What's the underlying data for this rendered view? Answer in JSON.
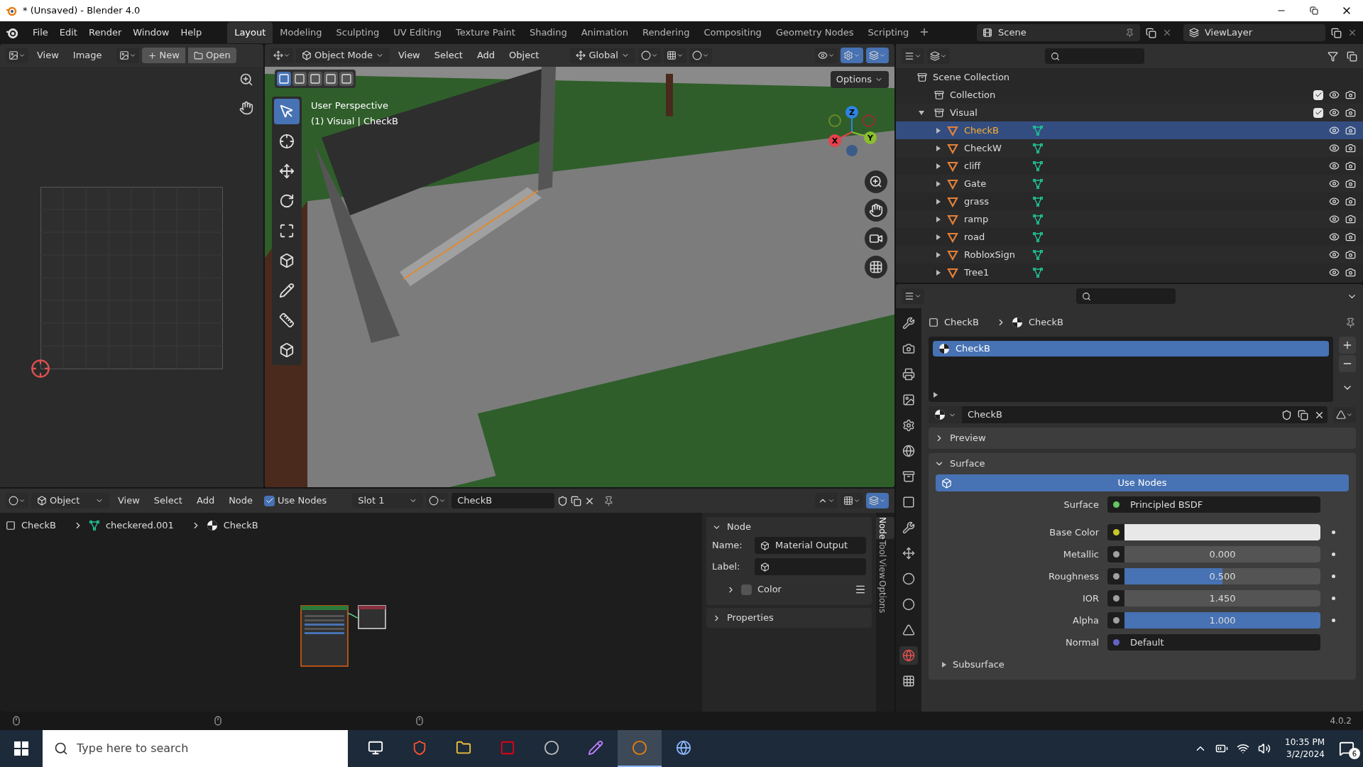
{
  "window": {
    "title": "* (Unsaved) - Blender 4.0"
  },
  "menu": [
    "File",
    "Edit",
    "Render",
    "Window",
    "Help"
  ],
  "workspaces": [
    {
      "label": "Layout",
      "selected": true
    },
    {
      "label": "Modeling",
      "selected": false
    },
    {
      "label": "Sculpting",
      "selected": false
    },
    {
      "label": "UV Editing",
      "selected": false
    },
    {
      "label": "Texture Paint",
      "selected": false
    },
    {
      "label": "Shading",
      "selected": false
    },
    {
      "label": "Animation",
      "selected": false
    },
    {
      "label": "Rendering",
      "selected": false
    },
    {
      "label": "Compositing",
      "selected": false
    },
    {
      "label": "Geometry Nodes",
      "selected": false
    },
    {
      "label": "Scripting",
      "selected": false
    }
  ],
  "scene": "Scene",
  "view_layer": "ViewLayer",
  "image_editor": {
    "menu": [
      "View",
      "Image"
    ],
    "new_button": "New",
    "open_button": "Open"
  },
  "viewport": {
    "mode": "Object Mode",
    "menu": [
      "View",
      "Select",
      "Add",
      "Object"
    ],
    "orientation": "Global",
    "options": "Options",
    "info": [
      "User Perspective",
      "(1) Visual | CheckB"
    ],
    "axes": [
      "Z",
      "Y",
      "X"
    ]
  },
  "outliner": {
    "root": "Scene Collection",
    "collections": [
      {
        "name": "Collection",
        "checked": true
      },
      {
        "name": "Visual",
        "checked": true,
        "expanded": true,
        "children": [
          {
            "name": "CheckB",
            "selected": true
          },
          {
            "name": "CheckW",
            "selected": false
          },
          {
            "name": "cliff",
            "selected": false
          },
          {
            "name": "Gate",
            "selected": false
          },
          {
            "name": "grass",
            "selected": false
          },
          {
            "name": "ramp",
            "selected": false
          },
          {
            "name": "road",
            "selected": false
          },
          {
            "name": "RobloxSign",
            "selected": false
          },
          {
            "name": "Tree1",
            "selected": false
          }
        ]
      }
    ]
  },
  "properties": {
    "breadcrumb": [
      "CheckB",
      "CheckB"
    ],
    "slots": [
      {
        "name": "CheckB",
        "selected": true
      }
    ],
    "material": "CheckB",
    "panels": [
      {
        "title": "Preview",
        "expanded": false
      },
      {
        "title": "Surface",
        "expanded": true
      }
    ],
    "use_nodes": "Use Nodes",
    "fields": [
      {
        "kind": "link",
        "label": "Surface",
        "value": "Principled BSDF",
        "color": "#63c763"
      },
      {
        "kind": "color",
        "label": "Base Color",
        "color": "#c7c729"
      },
      {
        "kind": "number",
        "label": "Metallic",
        "value": "0.000",
        "color": "#a1a1a1"
      },
      {
        "kind": "slider",
        "label": "Roughness",
        "value": "0.500",
        "level": 0.5,
        "color": "#a1a1a1"
      },
      {
        "kind": "number",
        "label": "IOR",
        "value": "1.450",
        "color": "#a1a1a1"
      },
      {
        "kind": "slider",
        "label": "Alpha",
        "value": "1.000",
        "level": 1,
        "color": "#a1a1a1"
      },
      {
        "kind": "link",
        "label": "Normal",
        "value": "Default",
        "color": "#6363c7"
      }
    ],
    "subpanel": {
      "title": "Subsurface",
      "expanded": false
    }
  },
  "node_editor": {
    "mode": "Object",
    "menu": [
      "View",
      "Select",
      "Add",
      "Node"
    ],
    "use_nodes": {
      "label": "Use Nodes",
      "checked": true
    },
    "slot": "Slot 1",
    "material": "CheckB",
    "breadcrumb": [
      "CheckB",
      "checkered.001",
      "CheckB"
    ],
    "sidebar": {
      "panel": "Node",
      "expanded": true,
      "name_label": "Name:",
      "name": "Material Output",
      "label_label": "Label:",
      "color": {
        "label": "Color",
        "checked": false,
        "expanded": false
      },
      "properties": {
        "title": "Properties",
        "expanded": false
      }
    },
    "tabs": [
      {
        "label": "Node",
        "selected": true
      },
      {
        "label": "Tool",
        "selected": false
      },
      {
        "label": "View",
        "selected": false
      },
      {
        "label": "Options",
        "selected": false
      }
    ]
  },
  "status_bar": {
    "version": "4.0.2"
  },
  "taskbar": {
    "search_placeholder": "Type here to search",
    "apps": [
      {
        "kind": "taskview",
        "selected": false
      },
      {
        "kind": "brave",
        "selected": false
      },
      {
        "kind": "explorer",
        "selected": false
      },
      {
        "kind": "switch",
        "selected": false
      },
      {
        "kind": "paw",
        "selected": false
      },
      {
        "kind": "pen",
        "selected": false
      },
      {
        "kind": "blender",
        "selected": true
      },
      {
        "kind": "paint",
        "selected": false
      }
    ],
    "time": "10:35 PM",
    "date": "3/2/2024",
    "notifications": "6"
  }
}
